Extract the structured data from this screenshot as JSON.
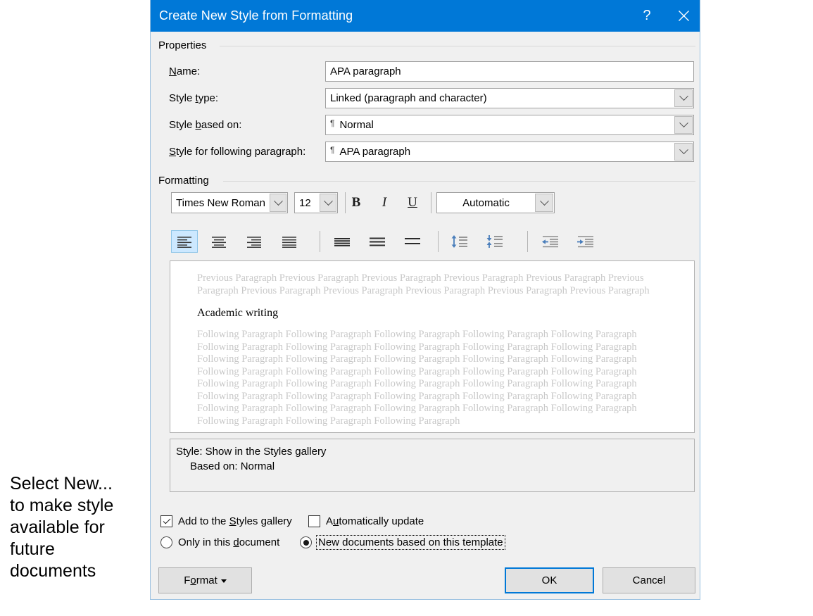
{
  "annotation": {
    "text": "Select New...\nto make style\navailable for\nfuture\ndocuments"
  },
  "dialog": {
    "title": "Create New Style from Formatting",
    "help_icon": "?",
    "close_icon": "close-icon"
  },
  "properties": {
    "group_label": "Properties",
    "name_label_pre": "",
    "name_label_accel": "N",
    "name_label_post": "ame:",
    "name_value": "APA paragraph",
    "style_type_label_pre": "Style ",
    "style_type_label_accel": "t",
    "style_type_label_post": "ype:",
    "style_type_value": "Linked (paragraph and character)",
    "style_based_label_pre": "Style ",
    "style_based_label_accel": "b",
    "style_based_label_post": "ased on:",
    "style_based_value": "Normal",
    "style_based_glyph": "¶",
    "style_following_label_pre": "",
    "style_following_label_accel": "S",
    "style_following_label_post": "tyle for following paragraph:",
    "style_following_value": "APA paragraph",
    "style_following_glyph": "¶"
  },
  "formatting": {
    "group_label": "Formatting",
    "font_family": "Times New Roman",
    "font_size": "12",
    "bold": "B",
    "italic": "I",
    "underline": "U",
    "font_color": "Automatic",
    "align_buttons": [
      {
        "name": "align-left-icon",
        "selected": true
      },
      {
        "name": "align-center-icon",
        "selected": false
      },
      {
        "name": "align-right-icon",
        "selected": false
      },
      {
        "name": "align-justify-icon",
        "selected": false
      }
    ],
    "linespacing_buttons": [
      {
        "name": "line-spacing-single-icon"
      },
      {
        "name": "line-spacing-1-5-icon"
      },
      {
        "name": "line-spacing-double-icon"
      }
    ],
    "paragraph_spacing_buttons": [
      {
        "name": "decrease-paragraph-spacing-icon"
      },
      {
        "name": "increase-paragraph-spacing-icon"
      }
    ],
    "indent_buttons": [
      {
        "name": "decrease-indent-icon"
      },
      {
        "name": "increase-indent-icon"
      }
    ]
  },
  "preview": {
    "previous_text": "Previous Paragraph Previous Paragraph Previous Paragraph Previous Paragraph Previous Paragraph Previous Paragraph Previous Paragraph Previous Paragraph Previous Paragraph Previous Paragraph Previous Paragraph",
    "sample_text": "Academic writing",
    "following_text": "Following Paragraph Following Paragraph Following Paragraph Following Paragraph Following Paragraph Following Paragraph Following Paragraph Following Paragraph Following Paragraph Following Paragraph Following Paragraph Following Paragraph Following Paragraph Following Paragraph Following Paragraph Following Paragraph Following Paragraph Following Paragraph Following Paragraph Following Paragraph Following Paragraph Following Paragraph Following Paragraph Following Paragraph Following Paragraph Following Paragraph Following Paragraph Following Paragraph Following Paragraph Following Paragraph Following Paragraph Following Paragraph Following Paragraph Following Paragraph Following Paragraph Following Paragraph Following Paragraph Following Paragraph"
  },
  "description": {
    "line1": "Style: Show in the Styles gallery",
    "line2": "Based on: Normal"
  },
  "options": {
    "add_gallery_pre": "Add to the ",
    "add_gallery_accel": "S",
    "add_gallery_post": "tyles gallery",
    "add_gallery_checked": true,
    "auto_update_pre": "A",
    "auto_update_accel": "u",
    "auto_update_post": "tomatically update",
    "auto_update_checked": false,
    "only_doc_pre": "Only in this ",
    "only_doc_accel": "d",
    "only_doc_post": "ocument",
    "only_doc_selected": false,
    "new_docs_label": "New documents based on this template",
    "new_docs_selected": true
  },
  "buttons": {
    "format_pre": "F",
    "format_accel": "o",
    "format_post": "rmat",
    "ok": "OK",
    "cancel": "Cancel"
  },
  "colors": {
    "accent": "#0078d7",
    "dialog_bg": "#f0f0f0",
    "selection": "#cce8ff",
    "icon_blue": "#4a7ebb"
  }
}
